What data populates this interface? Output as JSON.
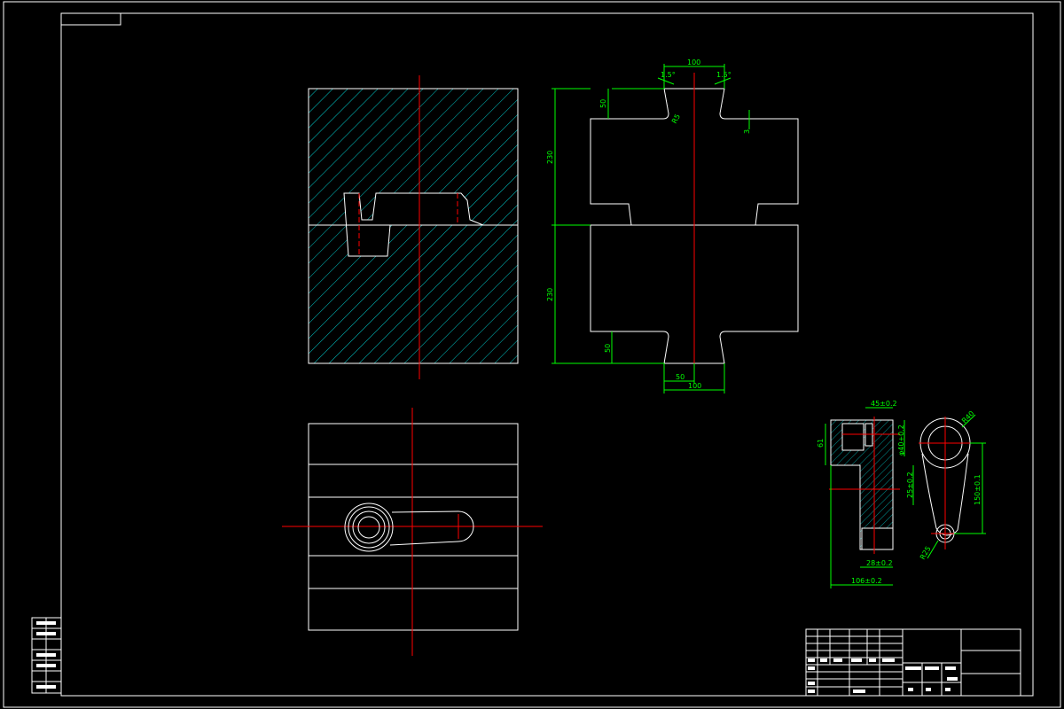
{
  "colors": {
    "background": "#000000",
    "outline": "#ffffff",
    "dimension": "#00ff00",
    "centerline": "#ff0000",
    "hatch": "#00c8c8"
  },
  "die_side_view": {
    "dim_top_width": "100",
    "dim_top_depth": "50",
    "dim_upper_height": "230",
    "dim_lower_height": "230",
    "dim_bottom_depth": "50",
    "dim_bottom_width": "100",
    "dim_bottom_half": "50",
    "dim_left_angle": "1.5°",
    "dim_right_angle": "1.5°",
    "dim_radius": "R5",
    "dim_small": "3"
  },
  "part_drawing": {
    "dim_top": "45±0.2",
    "dim_left_height": "61",
    "dim_bore": "φ40+0.2",
    "dim_depth": "25±0.2",
    "dim_step": "28±0.2",
    "dim_overall": "106±0.2",
    "dim_center_distance": "150±0.1",
    "dim_big_radius": "R40",
    "dim_small_radius": "R25"
  }
}
